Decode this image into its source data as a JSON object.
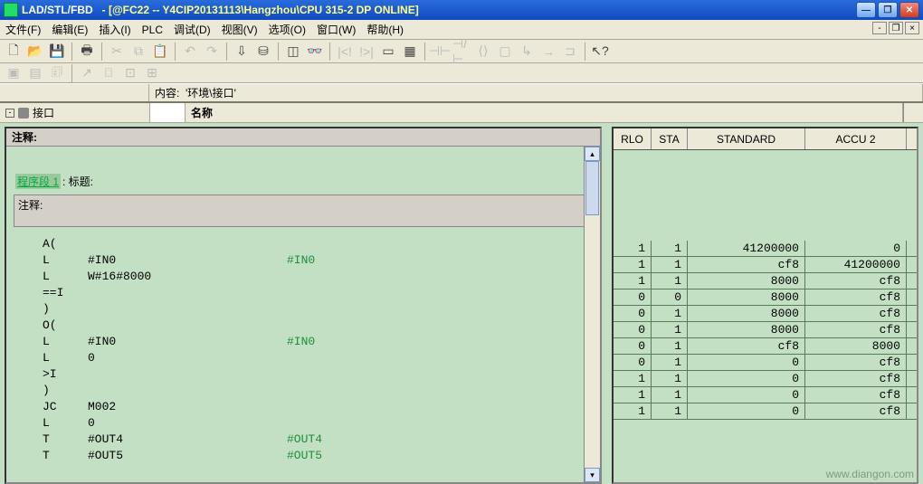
{
  "title": {
    "main": "LAD/STL/FBD",
    "sub": "- [@FC22 -- Y4CIP20131113\\Hangzhou\\CPU 315-2 DP  ONLINE]"
  },
  "menus": [
    "文件(F)",
    "编辑(E)",
    "插入(I)",
    "PLC",
    "调试(D)",
    "视图(V)",
    "选项(O)",
    "窗口(W)",
    "帮助(H)"
  ],
  "subbar": {
    "label": "内容:",
    "value": "'环境\\接口'"
  },
  "namebar": {
    "tree": "接口",
    "name_label": "名称"
  },
  "left": {
    "header": "注释:",
    "segment": {
      "link": "程序段 1",
      "rest": ": 标题:"
    },
    "comment_label": "注释:",
    "code": [
      {
        "op": "A(",
        "arg": "",
        "live": ""
      },
      {
        "op": "L",
        "arg": "#IN0",
        "live": "#IN0"
      },
      {
        "op": "L",
        "arg": "W#16#8000",
        "live": ""
      },
      {
        "op": "==I",
        "arg": "",
        "live": ""
      },
      {
        "op": ")",
        "arg": "",
        "live": ""
      },
      {
        "op": "O(",
        "arg": "",
        "live": ""
      },
      {
        "op": "L",
        "arg": "#IN0",
        "live": "#IN0"
      },
      {
        "op": "L",
        "arg": "0",
        "live": ""
      },
      {
        "op": ">I",
        "arg": "",
        "live": ""
      },
      {
        "op": ")",
        "arg": "",
        "live": ""
      },
      {
        "op": "JC",
        "arg": "M002",
        "live": ""
      },
      {
        "op": "L",
        "arg": "0",
        "live": ""
      },
      {
        "op": "T",
        "arg": "#OUT4",
        "live": "#OUT4"
      },
      {
        "op": "T",
        "arg": "#OUT5",
        "live": "#OUT5"
      }
    ]
  },
  "right": {
    "headers": [
      "RLO",
      "STA",
      "STANDARD",
      "ACCU 2"
    ],
    "rows": [
      [
        "1",
        "1",
        "41200000",
        "0"
      ],
      [
        "1",
        "1",
        "cf8",
        "41200000"
      ],
      [
        "1",
        "1",
        "8000",
        "cf8"
      ],
      [
        "0",
        "0",
        "8000",
        "cf8"
      ],
      [
        "0",
        "1",
        "8000",
        "cf8"
      ],
      [
        "0",
        "1",
        "8000",
        "cf8"
      ],
      [
        "0",
        "1",
        "cf8",
        "8000"
      ],
      [
        "0",
        "1",
        "0",
        "cf8"
      ],
      [
        "1",
        "1",
        "0",
        "cf8"
      ],
      [
        "1",
        "1",
        "0",
        "cf8"
      ],
      [
        "1",
        "1",
        "0",
        "cf8"
      ]
    ]
  },
  "watermark": "www.diangon.com"
}
